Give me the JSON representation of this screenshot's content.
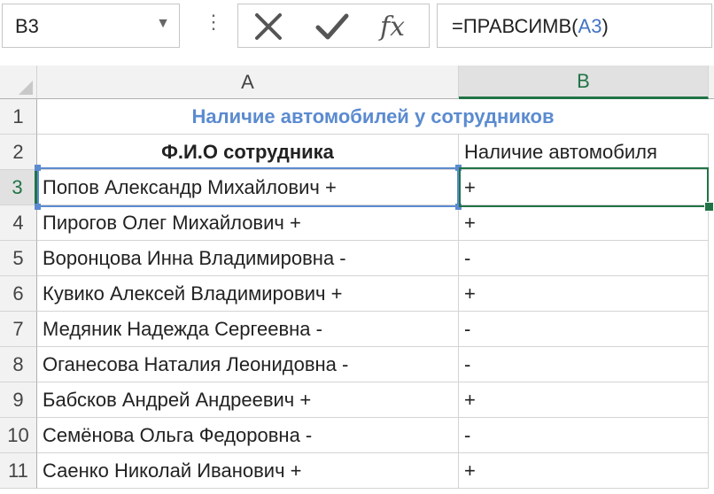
{
  "formula_bar": {
    "name_box": "B3",
    "formula_prefix": "=ПРАВСИМВ(",
    "formula_ref": "A3",
    "formula_suffix": ")",
    "options_glyph": "⋮",
    "cancel_icon": "close-icon",
    "enter_icon": "check-icon",
    "fx_label": "fx",
    "accent_color": "#217346",
    "ref_color": "#4472c4"
  },
  "columns": [
    "A",
    "B"
  ],
  "selected_column": "B",
  "selected_row": 3,
  "rows": [
    {
      "num": "1",
      "a": "Наличие автомобилей у сотрудников",
      "b": ""
    },
    {
      "num": "2",
      "a": "Ф.И.О сотрудника",
      "b": "Наличие автомобиля"
    },
    {
      "num": "3",
      "a": "Попов Александр  Михайлович +",
      "b": "+"
    },
    {
      "num": "4",
      "a": "Пирогов Олег Михайлович +",
      "b": "+"
    },
    {
      "num": "5",
      "a": "Воронцова Инна Владимировна -",
      "b": "-"
    },
    {
      "num": "6",
      "a": "Кувико Алексей Владимирович +",
      "b": "+"
    },
    {
      "num": "7",
      "a": "Медяник Надежда Сергеевна -",
      "b": "-"
    },
    {
      "num": "8",
      "a": "Оганесова Наталия Леонидовна -",
      "b": "-"
    },
    {
      "num": "9",
      "a": "Бабсков Андрей Андреевич +",
      "b": "+"
    },
    {
      "num": "10",
      "a": "Семёнова Ольга Федоровна -",
      "b": "-"
    },
    {
      "num": "11",
      "a": "Саенко Николай Иванович +",
      "b": "+"
    }
  ]
}
